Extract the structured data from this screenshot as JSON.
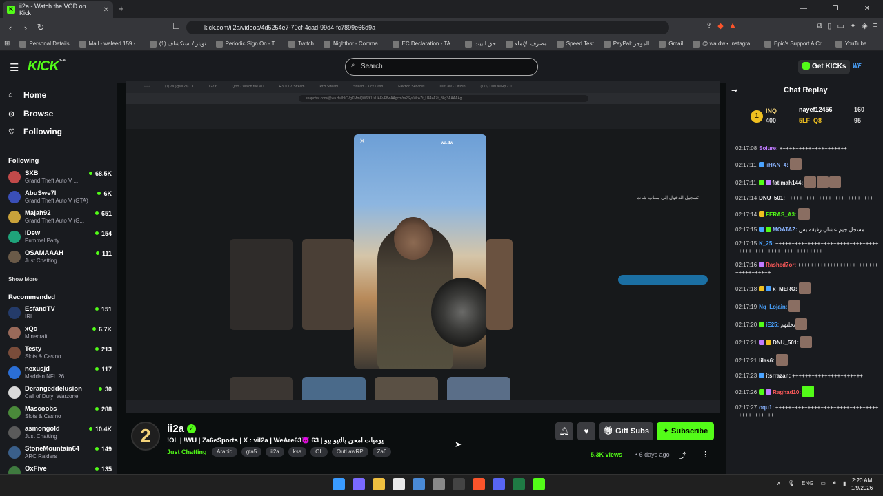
{
  "browser": {
    "tab_title": "ii2a - Watch the VOD on Kick",
    "url": "kick.com/ii2a/videos/4d5254e7-70cf-4cad-99d4-fc7899e66d9a",
    "bookmarks": [
      "Personal Details",
      "Mail - waleed 159 -...",
      "(1) تويتر / استكشاف",
      "Periodic Sign On - T...",
      "Twitch",
      "Nightbot - Comma...",
      "EC Declaration - TA...",
      "حق البيت",
      "مصرف الإنماء",
      "Speed Test",
      "PayPal: الموجز",
      "Gmail",
      "@ wa.dw • Instagra...",
      "Epic's Support A Cr...",
      "YouTube"
    ]
  },
  "header": {
    "logo": "KICK",
    "logo_badge": "BETA",
    "search_placeholder": "Search",
    "get_kicks": "Get KICKs"
  },
  "sidebar": {
    "nav": [
      {
        "label": "Home",
        "icon": "home-icon"
      },
      {
        "label": "Browse",
        "icon": "compass-icon"
      },
      {
        "label": "Following",
        "icon": "heart-icon"
      }
    ],
    "following_title": "Following",
    "following": [
      {
        "name": "SXB",
        "game": "Grand Theft Auto V ...",
        "viewers": "68.5K"
      },
      {
        "name": "AbuSwe7l",
        "game": "Grand Theft Auto V (GTA)",
        "viewers": "6K"
      },
      {
        "name": "Majah92",
        "game": "Grand Theft Auto V (G...",
        "viewers": "651"
      },
      {
        "name": "iDew",
        "game": "Pummel Party",
        "viewers": "154"
      },
      {
        "name": "OSAMAAAH",
        "game": "Just Chatting",
        "viewers": "111"
      }
    ],
    "show_more": "Show More",
    "recommended_title": "Recommended",
    "recommended": [
      {
        "name": "EsfandTV",
        "game": "IRL",
        "viewers": "151"
      },
      {
        "name": "xQc",
        "game": "Minecraft",
        "viewers": "6.7K"
      },
      {
        "name": "Testy",
        "game": "Slots & Casino",
        "viewers": "213"
      },
      {
        "name": "nexusjd",
        "game": "Madden NFL 26",
        "viewers": "117"
      },
      {
        "name": "Derangeddelusion",
        "game": "Call of Duty: Warzone",
        "viewers": "30"
      },
      {
        "name": "Mascoobs",
        "game": "Slots & Casino",
        "viewers": "288"
      },
      {
        "name": "asmongold",
        "game": "Just Chatting",
        "viewers": "10.4K"
      },
      {
        "name": "StoneMountain64",
        "game": "ARC Raiders",
        "viewers": "149"
      },
      {
        "name": "OxFive",
        "game": "",
        "viewers": "135"
      }
    ]
  },
  "video": {
    "snap_url": "snapchat.com/@wa.dw/bICVgKMmQW6fKUzUAEvF8wAAgcm/ra2SyaWrAZt_U44xAZt_Bkg3AAAAAg",
    "story_user": "wa.dw",
    "login_title": "تسجيل الدخول إلى سناب شات"
  },
  "channel": {
    "name": "ii2a",
    "title": "!OL | !WU | Za6eSports | X : vil2a | WeAre63😈 63 | يوميات امحن بالتيو بيو",
    "category": "Just Chatting",
    "tags": [
      "Arabic",
      "gta5",
      "ii2a",
      "ksa",
      "OL",
      "OutLawRP",
      "Za6"
    ],
    "gift_subs": "Gift Subs",
    "subscribe": "Subscribe",
    "views": "5.3K views",
    "ago": "6 days ago"
  },
  "chat": {
    "title": "Chat Replay",
    "gifters": [
      {
        "name": "INQ",
        "amount": "400"
      },
      {
        "name": "nayef12456",
        "amount": "160"
      },
      {
        "name": "5LF_Q8",
        "amount": "95"
      }
    ],
    "messages": [
      {
        "time": "02:17:08",
        "user": "Soiure:",
        "color": "#c07bff",
        "text": "+++++++++++++++++++++",
        "emotes": 0
      },
      {
        "time": "02:17:11",
        "user": "iiHAN_4:",
        "color": "#8ab4ff",
        "text": "",
        "emotes": 1
      },
      {
        "time": "02:17:11",
        "user": "fatimah144:",
        "color": "#efeff1",
        "text": "",
        "emotes": 3
      },
      {
        "time": "02:17:14",
        "user": "DNU_501:",
        "color": "#efeff1",
        "text": "+++++++++++++++++++++++++++",
        "emotes": 0
      },
      {
        "time": "02:17:14",
        "user": "FERAS_A3:",
        "color": "#53fc18",
        "text": "",
        "emotes": 1
      },
      {
        "time": "02:17:15",
        "user": "MOATAZ:",
        "color": "#8ab4ff",
        "text": "مسجل جيم عشان رفيقه بس",
        "emotes": 0
      },
      {
        "time": "02:17:15",
        "user": "K_25:",
        "color": "#4aa3ff",
        "text": "++++++++++++++++++++++++++++++++++++++++++++++++++++++++++++",
        "emotes": 0
      },
      {
        "time": "02:17:16",
        "user": "Rashed7or:",
        "color": "#ff5a5a",
        "text": "++++++++++++++++++++++++++++++++++++",
        "emotes": 0
      },
      {
        "time": "02:17:18",
        "user": "x_MERO:",
        "color": "#efeff1",
        "text": "",
        "emotes": 1
      },
      {
        "time": "02:17:19",
        "user": "Nq_Lojain:",
        "color": "#4aa3ff",
        "text": "",
        "emotes": 1
      },
      {
        "time": "02:17:20",
        "user": "iE25:",
        "color": "#4aa3ff",
        "text": "يخليهم",
        "emotes": 1
      },
      {
        "time": "02:17:21",
        "user": "DNU_501:",
        "color": "#efeff1",
        "text": "",
        "emotes": 1
      },
      {
        "time": "02:17:21",
        "user": "lilas6:",
        "color": "#efeff1",
        "text": "",
        "emotes": 1
      },
      {
        "time": "02:17:23",
        "user": "itsrrazan:",
        "color": "#efeff1",
        "text": "++++++++++++++++++++++",
        "emotes": 0
      },
      {
        "time": "02:17:26",
        "user": "Raghad10:",
        "color": "#ff5a5a",
        "text": "",
        "emotes": 1
      },
      {
        "time": "02:17:27",
        "user": "oqu1:",
        "color": "#8ab4ff",
        "text": "++++++++++++++++++++++++++++++++++++++++++++",
        "emotes": 0
      }
    ]
  },
  "taskbar": {
    "lang": "ENG",
    "time": "2:20 AM",
    "date": "1/9/2026"
  }
}
